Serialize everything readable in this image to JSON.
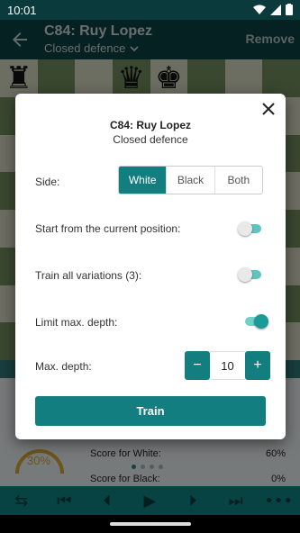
{
  "status_bar": {
    "time": "10:01"
  },
  "app_bar": {
    "title": "C84: Ruy Lopez",
    "subtitle": "Closed defence",
    "remove_label": "Remove"
  },
  "board": {
    "squares": [
      [
        "♜",
        "",
        "",
        "♛",
        "♚",
        "",
        "",
        ""
      ],
      [
        "",
        "",
        "♝",
        "",
        "",
        "",
        "",
        ""
      ],
      [
        "",
        "",
        "",
        "",
        "",
        "",
        "",
        ""
      ],
      [
        "",
        "",
        "",
        "",
        "",
        "",
        "",
        ""
      ],
      [
        "",
        "",
        "",
        "",
        "",
        "",
        "",
        ""
      ],
      [
        "",
        "",
        "",
        "",
        "",
        "",
        "",
        ""
      ],
      [
        "",
        "",
        "",
        "",
        "",
        "",
        "",
        ""
      ],
      [
        "",
        "",
        "",
        "",
        "",
        "",
        "",
        ""
      ]
    ]
  },
  "below": {
    "gauge_value": "30%",
    "score_white_label": "Score for White:",
    "score_white_value": "60%",
    "score_black_label": "Score for Black:",
    "score_black_value": "0%"
  },
  "dialog": {
    "title": "C84: Ruy Lopez",
    "subtitle": "Closed defence",
    "side_label": "Side:",
    "side_options": [
      "White",
      "Black",
      "Both"
    ],
    "side_selected": "White",
    "start_current_label": "Start from the current position:",
    "start_current_on": false,
    "train_all_label": "Train all variations (3):",
    "train_all_on": false,
    "limit_depth_label": "Limit max. depth:",
    "limit_depth_on": true,
    "max_depth_label": "Max. depth:",
    "max_depth_value": "10",
    "minus_label": "−",
    "plus_label": "+",
    "train_label": "Train"
  },
  "colors": {
    "accent": "#137e80",
    "app_bar": "#0c3d3f",
    "board_light": "#c7c9b3",
    "board_dark": "#6b8458"
  }
}
